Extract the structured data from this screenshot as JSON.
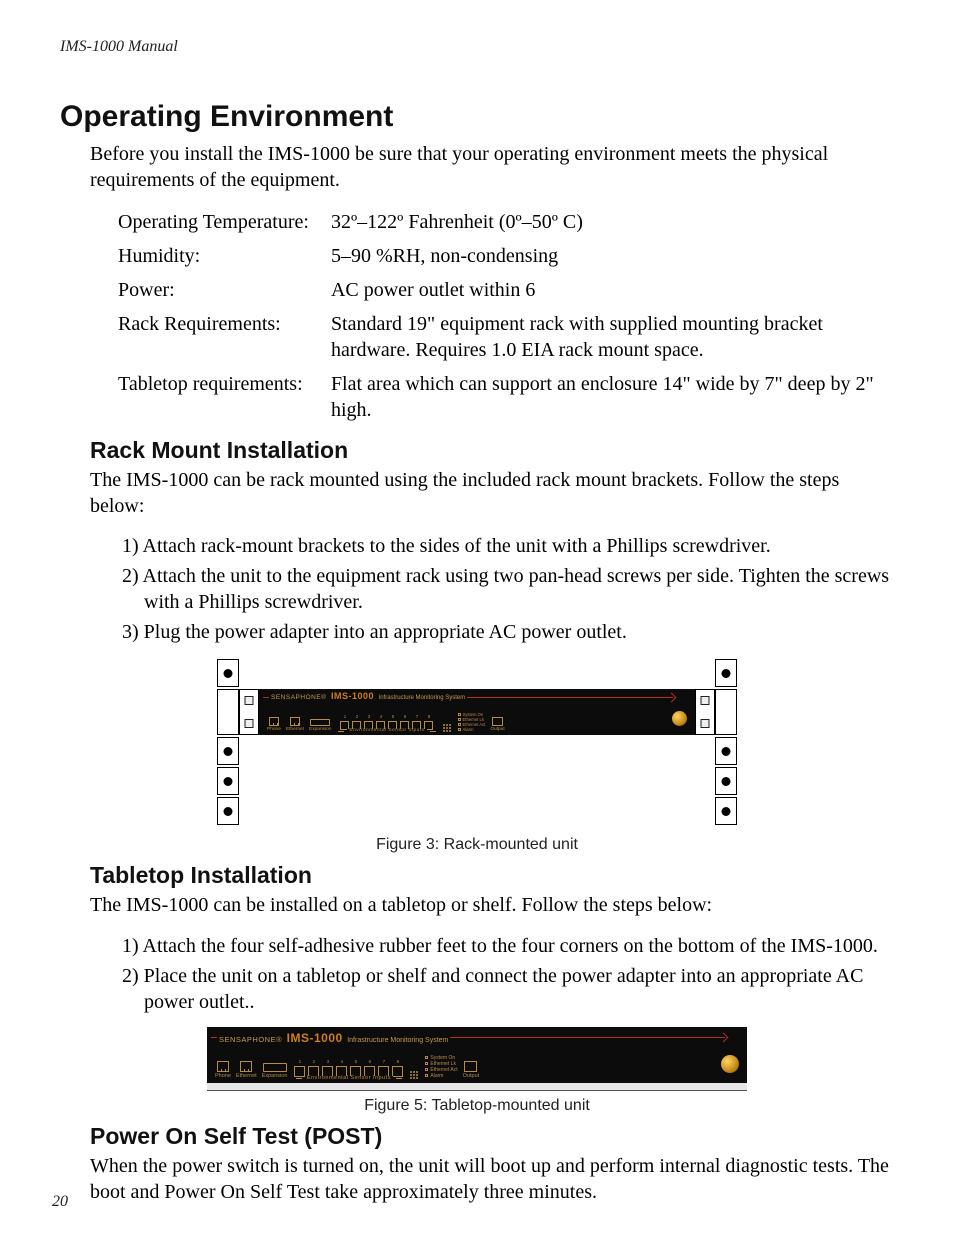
{
  "running_header": "IMS-1000 Manual",
  "page_number": "20",
  "h1": "Operating Environment",
  "intro": "Before you install the IMS-1000 be sure that your operating environment meets the physical requirements of the equipment.",
  "specs": [
    {
      "label": "Operating Temperature:",
      "value": "32º–122º Fahrenheit (0º–50º C)"
    },
    {
      "label": "Humidity:",
      "value": "5–90 %RH, non-condensing"
    },
    {
      "label": "Power:",
      "value": "AC power outlet within 6"
    },
    {
      "label": "Rack Requirements:",
      "value": "Standard 19\" equipment rack with supplied mounting bracket hardware. Requires 1.0 EIA rack mount space."
    },
    {
      "label": "Tabletop requirements:",
      "value": "Flat area which can support an enclosure 14\" wide by 7\" deep by 2\" high."
    }
  ],
  "rack": {
    "heading": "Rack Mount Installation",
    "intro": "The IMS-1000 can be rack mounted using the included rack mount brackets.  Follow the steps below:",
    "steps": [
      "1) Attach rack-mount brackets to the sides of the unit with a Phillips screwdriver.",
      "2) Attach the unit to the equipment rack using two pan-head screws per side.  Tighten the screws with a Phillips screwdriver.",
      "3) Plug the power adapter into an appropriate AC power outlet."
    ],
    "caption": "Figure 3: Rack-mounted unit"
  },
  "tabletop": {
    "heading": "Tabletop Installation",
    "intro": "The IMS-1000 can be installed on a tabletop or shelf.  Follow the steps below:",
    "steps": [
      "1) Attach the four self-adhesive rubber feet to the four corners on the bottom of the IMS-1000.",
      "2) Place the unit on a tabletop or shelf and connect the power adapter into an appropriate AC power outlet.."
    ],
    "caption": "Figure 5: Tabletop-mounted unit"
  },
  "post": {
    "heading": "Power On Self Test (POST)",
    "body": "When the power switch is turned on, the unit will boot up and perform internal diagnostic tests. The boot and Power On Self Test take approximately three minutes."
  },
  "device": {
    "brand": "SENSAPHONE®",
    "model": "IMS-1000",
    "subtitle": "Infrastructure Monitoring System",
    "ports": {
      "phone": "Phone",
      "ethernet": "Ethernet",
      "expansion": "Expansion",
      "sensor_numbers": [
        "1",
        "2",
        "3",
        "4",
        "5",
        "6",
        "7",
        "8"
      ],
      "sensor_label": "Environmental Sensor Inputs",
      "output": "Output"
    },
    "leds": [
      "System On",
      "Ethernet Lk",
      "Ethernet Act",
      "Alarm"
    ]
  }
}
